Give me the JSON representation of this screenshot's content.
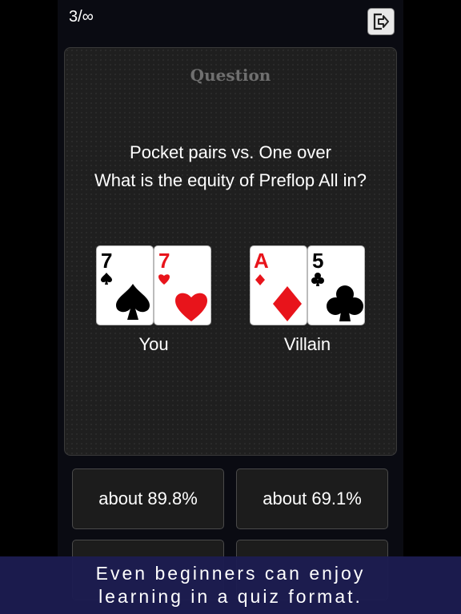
{
  "header": {
    "counter": "3/∞",
    "exit_icon": "exit-icon"
  },
  "question": {
    "title": "Question",
    "line1": "Pocket pairs vs. One over",
    "line2": "What is the equity of Preflop All in?"
  },
  "hands": {
    "you": {
      "label": "You",
      "cards": [
        {
          "rank": "7",
          "suit": "spade"
        },
        {
          "rank": "7",
          "suit": "heart"
        }
      ]
    },
    "villain": {
      "label": "Villain",
      "cards": [
        {
          "rank": "A",
          "suit": "diamond"
        },
        {
          "rank": "5",
          "suit": "club"
        }
      ]
    }
  },
  "answers": [
    "about 89.8%",
    "about 69.1%"
  ],
  "banner": {
    "line1": "Even beginners can enjoy",
    "line2": "learning in a quiz format."
  },
  "colors": {
    "red_suit": "#e8141b",
    "black_suit": "#000000",
    "banner_bg": "#1c1c50"
  }
}
